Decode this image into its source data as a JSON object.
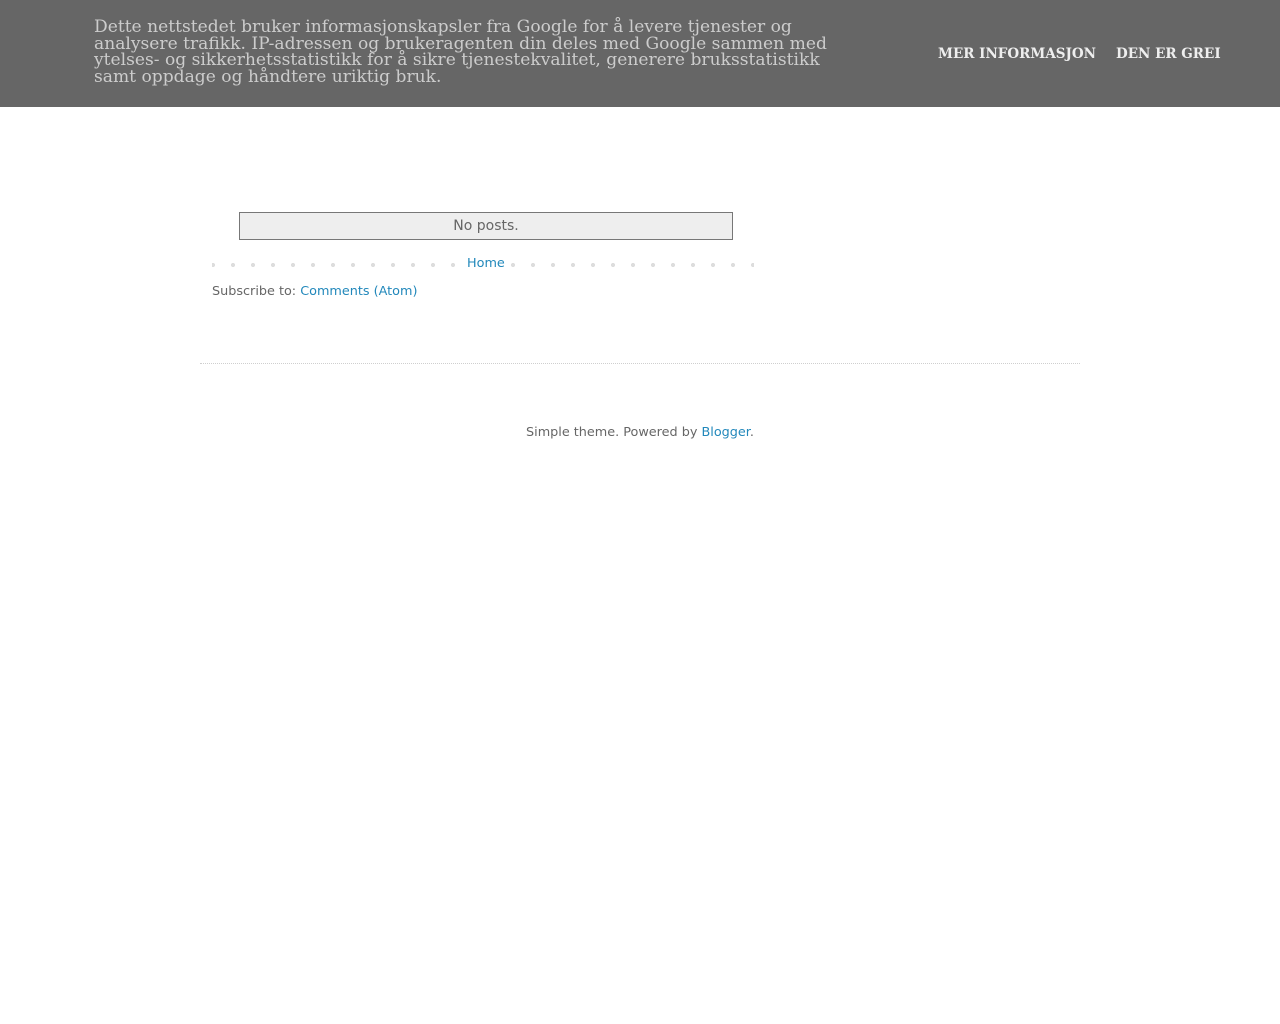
{
  "cookie_notice": {
    "message": "Dette nettstedet bruker informasjonskapsler fra Google for å levere tjenester og analysere trafikk. IP-adressen og brukeragenten din deles med Google sammen med ytelses- og sikkerhetsstatistikk for å sikre tjenestekvalitet, generere bruksstatistikk samt oppdage og håndtere uriktig bruk.",
    "more_info_label": "MER INFORMASJON",
    "accept_label": "DEN ER GREI"
  },
  "main": {
    "no_posts": "No posts.",
    "pager": {
      "home_label": "Home"
    },
    "subscribe": {
      "prefix": "Subscribe to:",
      "comments_link": "Comments (Atom)"
    }
  },
  "footer": {
    "text": "Simple theme. Powered by",
    "link": "Blogger",
    "suffix": "."
  },
  "colors": {
    "banner_background": "#666666",
    "banner_text": "#cccccc",
    "banner_links": "#eeeeee",
    "link": "#2288bb",
    "muted_text": "#666666",
    "no_posts_background": "#eeeeee"
  }
}
